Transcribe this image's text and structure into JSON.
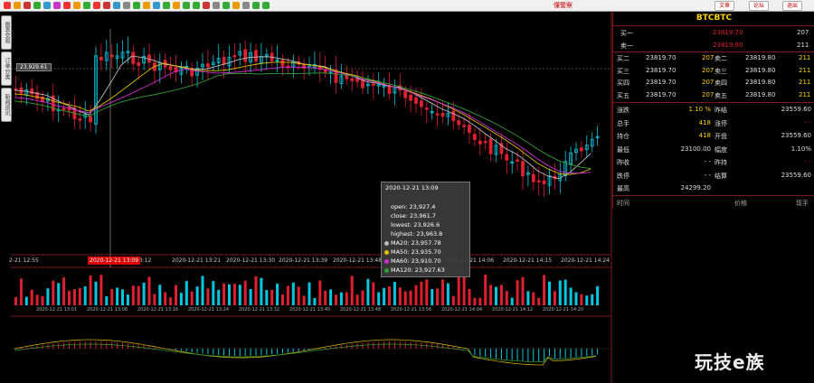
{
  "toolbar": {
    "title": "懂警察",
    "buttons": [
      {
        "label": "文章"
      },
      {
        "label": "论坛"
      },
      {
        "label": "退出"
      }
    ]
  },
  "side_tabs": [
    {
      "label": "图表交易"
    },
    {
      "label": "订单分类"
    },
    {
      "label": "新闻资讯"
    }
  ],
  "quote": {
    "symbol": "BTCBTC",
    "bid1_label": "买一",
    "bid1_price": "23819.70",
    "bid1_vol": "207",
    "ask1_label": "卖一",
    "ask1_price": "23819.80",
    "ask1_vol": "211",
    "depth": [
      {
        "bl": "买二",
        "bp": "23819.70",
        "bv": "207",
        "al": "卖二",
        "ap": "23819.80",
        "av": "211"
      },
      {
        "bl": "买三",
        "bp": "23819.70",
        "bv": "207",
        "al": "卖三",
        "ap": "23819.80",
        "av": "211"
      },
      {
        "bl": "买四",
        "bp": "23819.70",
        "bv": "207",
        "al": "卖四",
        "ap": "23819.80",
        "av": "211"
      },
      {
        "bl": "买五",
        "bp": "23819.70",
        "bv": "207",
        "al": "卖五",
        "ap": "23819.80",
        "av": "211"
      }
    ],
    "stats": [
      {
        "l1": "涨跌",
        "v1": "1.10 %",
        "l2": "昨结",
        "v2": "23559.60"
      },
      {
        "l1": "总手",
        "v1": "418",
        "l2": "涨停",
        "v2": "- -"
      },
      {
        "l1": "持仓",
        "v1": "418",
        "l2": "开盘",
        "v2": "23559.60"
      },
      {
        "l1": "最低",
        "v1": "23100.00",
        "l2": "幅度",
        "v2": "1.10%"
      },
      {
        "l1": "昨收",
        "v1": "- -",
        "l2": "昨持",
        "v2": "- -"
      },
      {
        "l1": "跌停",
        "v1": "- -",
        "l2": "结算",
        "v2": "23559.60"
      },
      {
        "l1": "最高",
        "v1": "24299.20",
        "l2": "",
        "v2": ""
      }
    ],
    "trade_headers": [
      "时间",
      "价格",
      "现手"
    ]
  },
  "crosshair": {
    "price_label": "23,929.61",
    "time_label": "2020-12-21 13:09"
  },
  "tooltip": {
    "time": "2020-12-21 13:09",
    "open": "open: 23,927.4",
    "close": "close: 23,961.7",
    "lowest": "lowest: 23,926.6",
    "highest": "highest: 23,963.8",
    "ma": [
      {
        "text": "MA20: 23,957.78",
        "color": "#bbbbbb"
      },
      {
        "text": "MA50: 23,935.70",
        "color": "#e0c000"
      },
      {
        "text": "MA60: 23,910.70",
        "color": "#d030d0"
      },
      {
        "text": "MA120: 23,927.63",
        "color": "#30a030"
      }
    ]
  },
  "x_axis_main": [
    "2-21 12:55",
    "2020-12-21 13:09",
    "13:12",
    "2020-12-21 13:21",
    "2020-12-21 13:30",
    "2020-12-21 13:39",
    "2020-12-21 13:48",
    "2020-12-21 13:57",
    "2020-12-21 14:06",
    "2020-12-21 14:15",
    "2020-12-21 14:24"
  ],
  "x_axis_small": [
    "2020-12-21 13:01",
    "2020-12-21 13:08",
    "2020-12-21 13:16",
    "2020-12-21 13:24",
    "2020-12-21 13:32",
    "2020-12-21 13:40",
    "2020-12-21 13:48",
    "2020-12-21 13:56",
    "2020-12-21 14:04",
    "2020-12-21 14:12",
    "2020-12-21 14:20"
  ],
  "watermark": "玩技e族",
  "colors": {
    "up": "#00c8e0",
    "down": "#e02030",
    "grid": "#7a1a1a",
    "accent": "#ffd200"
  }
}
